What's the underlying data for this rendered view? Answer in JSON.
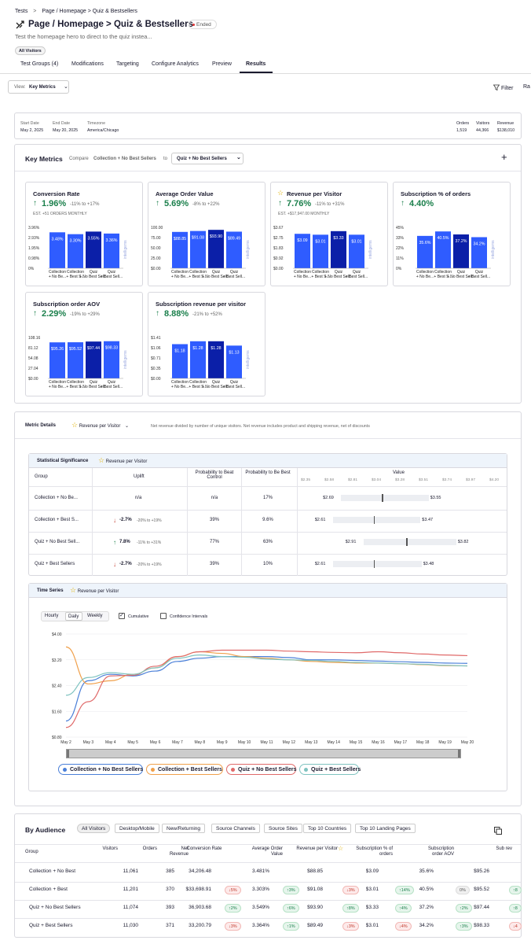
{
  "breadcrumb": {
    "root": "Tests",
    "sep": ">",
    "path": "Page / Homepage > Quiz & Bestsellers"
  },
  "header": {
    "title": "Page / Homepage > Quiz & Bestsellers",
    "status": "Ended",
    "description": "Test the homepage hero to direct to the quiz instea...",
    "audience_chip": "All Visitors"
  },
  "tabs": [
    "Test Groups (4)",
    "Modifications",
    "Targeting",
    "Configure Analytics",
    "Preview",
    "Results"
  ],
  "toolbar": {
    "view_label": "View:",
    "view_value": "Key Metrics",
    "filter": "Filter",
    "ra": "Ra"
  },
  "summary": {
    "start_label": "Start Date",
    "start": "May 2, 2025",
    "end_label": "End Date",
    "end": "May 20, 2025",
    "tz_label": "Timezone",
    "tz": "America/Chicago",
    "orders_label": "Orders",
    "orders": "1,519",
    "visitors_label": "Visitors",
    "visitors": "44,366",
    "revenue_label": "Revenue",
    "revenue": "$138,010"
  },
  "key_metrics": {
    "title": "Key Metrics",
    "compare_prefix": "Compare",
    "compare_group": "Collection + No Best Sellers",
    "compare_to": "to",
    "compare_target": "Quiz + No Best Sellers",
    "add": "+"
  },
  "colors": {
    "accent": "#2f5cff",
    "dark_bar": "#0b1fa8",
    "green": "#1a7f4b",
    "red": "#c0392b",
    "blue": "#4a7fd8",
    "orange": "#f0a04b",
    "redline": "#e06a6a",
    "teal": "#7fc3c0"
  },
  "metric_cards": [
    {
      "title": "Conversion Rate",
      "value": "1.96%",
      "range": "-11% to +17%",
      "note": "EST. +51 ORDERS MONTHLY",
      "star": false,
      "yticks": [
        "3.96%",
        "2.93%",
        "1.95%",
        "0.98%",
        "0%"
      ],
      "values": [
        3.48,
        3.3,
        3.55,
        3.36
      ],
      "labels": [
        "3.48%",
        "3.30%",
        "3.55%",
        "3.36%"
      ],
      "ymax": 3.96
    },
    {
      "title": "Average Order Value",
      "value": "5.69%",
      "range": "-8% to +22%",
      "note": "",
      "star": false,
      "yticks": [
        "100.00",
        "75.00",
        "50.00",
        "25.00",
        "$0.00"
      ],
      "values": [
        88.85,
        91.08,
        93.9,
        89.49
      ],
      "labels": [
        "$88.85",
        "$91.08",
        "$93.90",
        "$89.49"
      ],
      "ymax": 100
    },
    {
      "title": "Revenue per Visitor",
      "value": "7.76%",
      "range": "-11% to +31%",
      "note": "EST. +$17,947.00 MONTHLY",
      "star": true,
      "yticks": [
        "$3.67",
        "$2.75",
        "$1.83",
        "$0.92",
        "$0.00"
      ],
      "values": [
        3.09,
        3.01,
        3.33,
        3.01
      ],
      "labels": [
        "$3.09",
        "$3.01",
        "$3.33",
        "$3.01"
      ],
      "ymax": 3.67
    },
    {
      "title": "Subscription % of orders",
      "value": "4.40%",
      "range": "",
      "note": "",
      "star": false,
      "yticks": [
        "45%",
        "33%",
        "22%",
        "11%",
        "0%"
      ],
      "values": [
        35.6,
        40.5,
        37.2,
        34.2
      ],
      "labels": [
        "35.6%",
        "40.5%",
        "37.2%",
        "34.2%"
      ],
      "ymax": 45
    },
    {
      "title": "Subscription order AOV",
      "value": "2.29%",
      "range": "-19% to +29%",
      "note": "",
      "star": false,
      "yticks": [
        "108.16",
        "81.12",
        "54.08",
        "27.04",
        "$0.00"
      ],
      "values": [
        95.26,
        95.52,
        97.44,
        98.33
      ],
      "labels": [
        "$95.26",
        "$95.52",
        "$97.44",
        "$98.33"
      ],
      "ymax": 108.16
    },
    {
      "title": "Subscription revenue per visitor",
      "value": "8.88%",
      "range": "-21% to +52%",
      "note": "",
      "star": false,
      "yticks": [
        "$1.41",
        "$1.06",
        "$0.71",
        "$0.35",
        "$0.00"
      ],
      "values": [
        1.18,
        1.28,
        1.28,
        1.13
      ],
      "labels": [
        "$1.18",
        "$1.28",
        "$1.28",
        "$1.13"
      ],
      "ymax": 1.41
    }
  ],
  "bar_categories": [
    "Collection + No Be...",
    "Collection + Best S...",
    "Quiz + No Best Sell...",
    "Quiz + Best Sell..."
  ],
  "intelligems_mark": "intelligems",
  "metric_details": {
    "title": "Metric Details",
    "metric": "Revenue per Visitor",
    "description": "Net revenue divided by number of unique visitors. Net revenue includes product and shipping revenue, net of discounts"
  },
  "stat_sig": {
    "title": "Statistical Significance",
    "metric": "Revenue per Visitor",
    "headers": [
      "Group",
      "Uplift",
      "Probability to Beat Control",
      "Probability to Be Best",
      "Value"
    ],
    "axis_ticks": [
      "$2.35",
      "$2.58",
      "$2.81",
      "$3.04",
      "$3.28",
      "$3.51",
      "$3.74",
      "$3.97",
      "$4.20"
    ],
    "rows": [
      {
        "group": "Collection + No Be...",
        "uplift": "n/a",
        "range": "",
        "dir": "none",
        "beat": "n/a",
        "best": "17%",
        "lo": "$2.69",
        "hi": "$3.55",
        "lo_v": 2.69,
        "hi_v": 3.55,
        "mid_v": 3.09
      },
      {
        "group": "Collection + Best S...",
        "uplift": "-2.7%",
        "range": "-20% to +19%",
        "dir": "down",
        "beat": "39%",
        "best": "9.6%",
        "lo": "$2.61",
        "hi": "$3.47",
        "lo_v": 2.61,
        "hi_v": 3.47,
        "mid_v": 3.01
      },
      {
        "group": "Quiz + No Best Sell...",
        "uplift": "7.8%",
        "range": "-11% to +31%",
        "dir": "up",
        "beat": "77%",
        "best": "63%",
        "lo": "$2.91",
        "hi": "$3.82",
        "lo_v": 2.91,
        "hi_v": 3.82,
        "mid_v": 3.33
      },
      {
        "group": "Quiz + Best Sellers",
        "uplift": "-2.7%",
        "range": "-20% to +19%",
        "dir": "down",
        "beat": "39%",
        "best": "10%",
        "lo": "$2.61",
        "hi": "$3.48",
        "lo_v": 2.61,
        "hi_v": 3.48,
        "mid_v": 3.01
      }
    ]
  },
  "time_series": {
    "title": "Time Series",
    "metric": "Revenue per Visitor",
    "granularity": [
      "Hourly",
      "Daily",
      "Weekly"
    ],
    "active": "Daily",
    "cumulative": "Cumulative",
    "confidence": "Confidence Intervals"
  },
  "chart_data": {
    "type": "line",
    "title": "",
    "x": [
      "May 2",
      "May 3",
      "May 4",
      "May 5",
      "May 6",
      "May 7",
      "May 8",
      "May 9",
      "May 10",
      "May 11",
      "May 12",
      "May 13",
      "May 14",
      "May 15",
      "May 16",
      "May 17",
      "May 18",
      "May 19",
      "May 20"
    ],
    "yticks": [
      "$4.00",
      "$3.20",
      "$2.40",
      "$1.60",
      "$0.80"
    ],
    "ylim": [
      0.8,
      4.0
    ],
    "series": [
      {
        "name": "Collection + No Best Sellers",
        "color": "#4a7fd8",
        "values": [
          1.3,
          2.55,
          2.75,
          2.7,
          2.85,
          3.15,
          3.25,
          3.3,
          3.3,
          3.3,
          3.27,
          3.2,
          3.2,
          3.18,
          3.16,
          3.14,
          3.12,
          3.1,
          3.09
        ]
      },
      {
        "name": "Collection + Best Sellers",
        "color": "#f0a04b",
        "values": [
          3.6,
          2.45,
          2.55,
          2.75,
          2.95,
          3.3,
          3.45,
          3.4,
          3.3,
          3.25,
          3.2,
          3.15,
          3.12,
          3.1,
          3.1,
          3.08,
          3.05,
          3.02,
          3.01
        ]
      },
      {
        "name": "Quiz + No Best Sellers",
        "color": "#e06a6a",
        "values": [
          1.1,
          1.9,
          2.7,
          2.72,
          3.0,
          3.3,
          3.45,
          3.5,
          3.5,
          3.5,
          3.47,
          3.45,
          3.43,
          3.42,
          3.45,
          3.42,
          3.38,
          3.35,
          3.33
        ]
      },
      {
        "name": "Quiz + Best Sellers",
        "color": "#7fc3c0",
        "values": [
          2.1,
          2.65,
          2.8,
          2.75,
          2.95,
          3.25,
          3.35,
          3.3,
          3.28,
          3.22,
          3.2,
          3.18,
          3.15,
          3.12,
          3.1,
          3.08,
          3.06,
          3.03,
          3.01
        ]
      }
    ]
  },
  "by_audience": {
    "title": "By Audience",
    "tabs": [
      "All Visitors",
      "Desktop/Mobile",
      "New/Returning",
      "Source Channels",
      "Source Sites",
      "Top 10 Countries",
      "Top 10 Landing Pages"
    ],
    "headers": [
      "Group",
      "Visitors",
      "Orders",
      "Net Revenue",
      "Conversion Rate",
      "Average Order Value",
      "Revenue per Visitor",
      "Subscription % of orders",
      "Subscription order AOV",
      "Sub rev"
    ],
    "rows": [
      {
        "group": "Collection + No Best",
        "visitors": "11,061",
        "orders": "385",
        "revenue": "34,206.48",
        "cr_badge": "",
        "cr_dir": "none",
        "cr": "3.481%",
        "aov_badge": "",
        "aov_dir": "none",
        "aov": "$88.85",
        "rpv_badge": "",
        "rpv_dir": "none",
        "rpv": "$3.09",
        "sub_badge": "",
        "sub_dir": "none",
        "sub": "35.6%",
        "saov_badge": "",
        "saov_dir": "none",
        "saov": "$95.26",
        "last_badge": "",
        "last_dir": "none"
      },
      {
        "group": "Collection + Best",
        "visitors": "11,201",
        "orders": "370",
        "revenue": "$33,698.91",
        "cr_badge": "5%",
        "cr_dir": "down",
        "cr": "3.303%",
        "aov_badge": "3%",
        "aov_dir": "up",
        "aov": "$91.08",
        "rpv_badge": "3%",
        "rpv_dir": "down",
        "rpv": "$3.01",
        "sub_badge": "14%",
        "sub_dir": "up",
        "sub": "40.5%",
        "saov_badge": "0%",
        "saov_dir": "none",
        "saov": "$95.52",
        "last_badge": "8",
        "last_dir": "up"
      },
      {
        "group": "Quiz + No Best Sellers",
        "visitors": "11,074",
        "orders": "393",
        "revenue": "36,903.68",
        "cr_badge": "2%",
        "cr_dir": "up",
        "cr": "3.549%",
        "aov_badge": "6%",
        "aov_dir": "up",
        "aov": "$93.90",
        "rpv_badge": "8%",
        "rpv_dir": "up",
        "rpv": "$3.33",
        "sub_badge": "4%",
        "sub_dir": "up",
        "sub": "37.2%",
        "saov_badge": "2%",
        "saov_dir": "up",
        "saov": "$97.44",
        "last_badge": "8",
        "last_dir": "up"
      },
      {
        "group": "Quiz + Best Sellers",
        "visitors": "11,030",
        "orders": "371",
        "revenue": "33,200.79",
        "cr_badge": "3%",
        "cr_dir": "down",
        "cr": "3.364%",
        "aov_badge": "1%",
        "aov_dir": "up",
        "aov": "$89.49",
        "rpv_badge": "3%",
        "rpv_dir": "down",
        "rpv": "$3.01",
        "sub_badge": "4%",
        "sub_dir": "down",
        "sub": "34.2%",
        "saov_badge": "3%",
        "saov_dir": "up",
        "saov": "$98.33",
        "last_badge": "4",
        "last_dir": "down"
      }
    ]
  }
}
